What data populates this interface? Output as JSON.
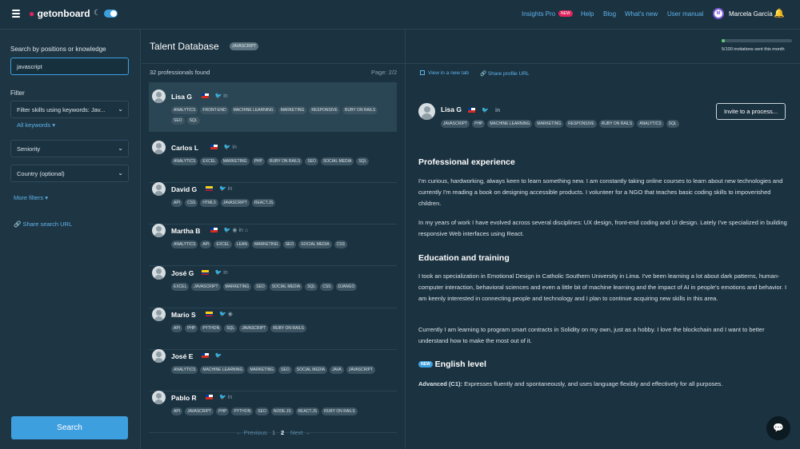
{
  "header": {
    "logo": "getonboard",
    "nav": [
      "Insights Pro",
      "Help",
      "Blog",
      "What's new",
      "User manual"
    ],
    "pro_badge": "NEW",
    "user_name": "Marcela García",
    "user_initial": "M"
  },
  "sidebar": {
    "search_label": "Search by positions or knowledge",
    "search_value": "javascript",
    "filter_label": "Filter",
    "skills_placeholder": "Filter skills using keywords: Jav...",
    "all_keywords": "All keywords",
    "seniority": "Seniority",
    "country": "Country (optional)",
    "more_filters": "More filters",
    "share_search": "Share search URL",
    "search_button": "Search"
  },
  "list": {
    "title": "Talent Database",
    "badge": "JAVASCRIPT",
    "found": "32 professionals found",
    "page": "Page: 2/2",
    "pager": {
      "prev": "← Previous",
      "p1": "1",
      "p2": "2",
      "next": "Next →"
    },
    "cards": [
      {
        "name": "Lisa G",
        "flag": "cl",
        "icons": "🐦 in",
        "tags": [
          "ANALYTICS",
          "FRONT-END",
          "MACHINE LEARNING",
          "MARKETING",
          "RESPONSIVE",
          "RUBY ON RAILS",
          "SEO",
          "SQL"
        ]
      },
      {
        "name": "Carlos L",
        "flag": "cl",
        "icons": "🐦 in",
        "tags": [
          "ANALYTICS",
          "EXCEL",
          "MARKETING",
          "PHP",
          "RUBY ON RAILS",
          "SEO",
          "SOCIAL MEDIA",
          "SQL"
        ]
      },
      {
        "name": "David G",
        "flag": "co",
        "icons": "🐦 in",
        "tags": [
          "API",
          "CSS",
          "HTML5",
          "JAVASCRIPT",
          "REACT.JS"
        ]
      },
      {
        "name": "Martha B",
        "flag": "cl",
        "icons": "🐦 ◉ in ⌂",
        "tags": [
          "ANALYTICS",
          "API",
          "EXCEL",
          "LEAN",
          "MARKETING",
          "SEO",
          "SOCIAL MEDIA",
          "CSS"
        ]
      },
      {
        "name": "José G",
        "flag": "co",
        "icons": "🐦 in",
        "tags": [
          "EXCEL",
          "JAVASCRIPT",
          "MARKETING",
          "SEO",
          "SOCIAL MEDIA",
          "SQL",
          "CSS",
          "DJANGO"
        ]
      },
      {
        "name": "Mario S",
        "flag": "co",
        "icons": "🐦 ◉",
        "tags": [
          "API",
          "PHP",
          "PYTHON",
          "SQL",
          "JAVASCRIPT",
          "RUBY ON RAILS"
        ]
      },
      {
        "name": "José E",
        "flag": "cl",
        "icons": "🐦",
        "tags": [
          "ANALYTICS",
          "MACHINE LEARNING",
          "MARKETING",
          "SEO",
          "SOCIAL MEDIA",
          "JAVA",
          "JAVASCRIPT"
        ]
      },
      {
        "name": "Pablo R",
        "flag": "cl",
        "icons": "🐦 in",
        "tags": [
          "API",
          "JAVASCRIPT",
          "PHP",
          "PYTHON",
          "SEO",
          "NODE.JS",
          "REACT.JS",
          "RUBY ON RAILS"
        ]
      }
    ]
  },
  "detail": {
    "view_tab": "View in a new tab",
    "share_profile": "Share profile URL",
    "name": "Lisa G",
    "tags": [
      "JAVASCRIPT",
      "PHP",
      "MACHINE LEARNING",
      "MARKETING",
      "RESPONSIVE",
      "RUBY ON RAILS",
      "ANALYTICS",
      "SQL"
    ],
    "invite": "Invite to a process...",
    "invitations_text": "5/100 invitations sent this month",
    "invitations_fraction": 0.05,
    "exp_title": "Professional experience",
    "exp_p1": "I'm curious, hardworking, always keen to learn something new. I am constantly taking online courses to learn about new technologies and currently I'm reading a book on designing accessible products. I volunteer for a NGO that teaches basic coding skills to impoverished children.",
    "exp_p2": "In my years of work I have evolved across several disciplines: UX design, front-end coding and UI design. Lately I've specialized in building responsive Web interfaces using React.",
    "edu_title": "Education and training",
    "edu_p1": "I took an specialization in Emotional Design in Catholic Southern University in Lima. I've been learning a lot about dark patterns, human-computer interaction, behavioral sciences and even a little bit of machine learning and the impact of AI in people's emotions and behavior. I am keenly interested in connecting people and technology and I plan to continue acquiring new skills in this area.",
    "edu_p2": "Currently I am learning to program smart contracts in Solidity on my own, just as a hobby. I love the blockchain and I want to better understand how to make the most out of it.",
    "eng_badge": "NEW",
    "eng_title": "English level",
    "eng_level": "Advanced (C1):",
    "eng_desc": "Expresses fluently and spontaneously, and uses language flexibly and effectively for all purposes."
  }
}
